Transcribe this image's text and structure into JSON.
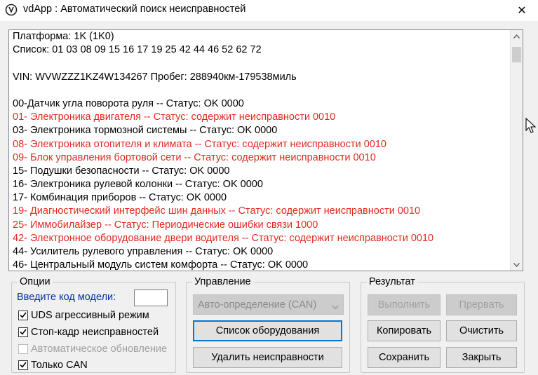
{
  "window": {
    "title": "vdApp : Автоматический поиск неисправностей",
    "close_glyph": "✕"
  },
  "log": {
    "lines": [
      {
        "text": "Платформа: 1K (1K0)",
        "error": false
      },
      {
        "text": "Список: 01 03 08 09 15 16 17 19 25 42 44 46 52 62 72",
        "error": false
      },
      {
        "text": "",
        "error": false
      },
      {
        "text": "VIN: WVWZZZ1KZ4W134267   Пробег: 288940км-179538миль",
        "error": false
      },
      {
        "text": "",
        "error": false
      },
      {
        "text": "00-Датчик угла поворота руля -- Статус: OK 0000",
        "error": false
      },
      {
        "text": "01- Электроника двигателя -- Статус: содержит неисправности 0010",
        "error": true
      },
      {
        "text": "03- Электроника тормозной системы -- Статус: OK 0000",
        "error": false
      },
      {
        "text": "08- Электроника отопителя и климата -- Статус: содержит неисправности 0010",
        "error": true
      },
      {
        "text": "09- Блок управления бортовой сети -- Статус: содержит неисправности 0010",
        "error": true
      },
      {
        "text": "15- Подушки безопасности -- Статус: OK 0000",
        "error": false
      },
      {
        "text": "16- Электроника рулевой колонки -- Статус: OK 0000",
        "error": false
      },
      {
        "text": "17- Комбинация приборов -- Статус: OK 0000",
        "error": false
      },
      {
        "text": "19- Диагностический интерфейс шин данных -- Статус: содержит неисправности 0010",
        "error": true
      },
      {
        "text": "25- Иммобилайзер -- Статус: Периодические ошибки связи 1000",
        "error": true
      },
      {
        "text": "42- Электронное оборудование двери водителя -- Статус: содержит неисправности 0010",
        "error": true
      },
      {
        "text": "44- Усилитель рулевого управления -- Статус: OK 0000",
        "error": false
      },
      {
        "text": "46- Центральный модуль систем комфорта -- Статус: OK 0000",
        "error": false
      }
    ]
  },
  "options": {
    "group_label": "Опции",
    "model_code_label": "Введите код модели:",
    "model_code_value": "",
    "uds_label": "UDS агрессивный режим",
    "uds_checked": true,
    "freeze_frame_label": "Стоп-кадр неисправностей",
    "freeze_frame_checked": true,
    "auto_update_label": "Автоматическое обновление",
    "auto_update_checked": false,
    "can_only_label": "Только CAN",
    "can_only_checked": true
  },
  "control": {
    "group_label": "Управление",
    "protocol_value": "Авто-определение (CAN)",
    "equipment_list_label": "Список оборудования",
    "delete_faults_label": "Удалить неисправности"
  },
  "result": {
    "group_label": "Результат",
    "execute_label": "Выполнить",
    "abort_label": "Прервать",
    "copy_label": "Копировать",
    "clear_label": "Очистить",
    "save_label": "Сохранить",
    "close_label": "Закрыть"
  },
  "colors": {
    "error_text": "#e02a1f",
    "focus_border": "#0078d7",
    "label_blue": "#0033a0"
  }
}
